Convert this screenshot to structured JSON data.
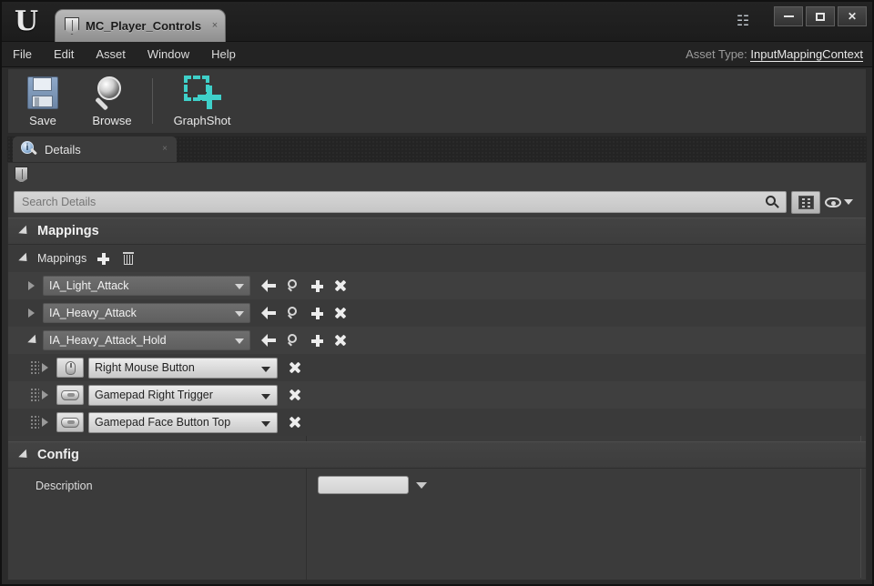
{
  "window": {
    "asset_tab_title": "MC_Player_Controls",
    "tab_close": "×",
    "minimize": "",
    "maximize": "",
    "close": "✕"
  },
  "menubar": {
    "items": [
      {
        "label": "File"
      },
      {
        "label": "Edit"
      },
      {
        "label": "Asset"
      },
      {
        "label": "Window"
      },
      {
        "label": "Help"
      }
    ],
    "asset_type_prefix": "Asset Type:",
    "asset_type_value": "InputMappingContext"
  },
  "toolbar": {
    "buttons": [
      {
        "label": "Save",
        "icon": "floppy-disk-icon"
      },
      {
        "label": "Browse",
        "icon": "magnifier-icon"
      },
      {
        "label": "GraphShot",
        "icon": "dashed-square-plus-icon"
      }
    ]
  },
  "details_tab": {
    "label": "Details",
    "close": "×"
  },
  "search": {
    "placeholder": "Search Details",
    "value": ""
  },
  "categories": {
    "mappings": {
      "title": "Mappings",
      "array_label": "Mappings",
      "add_tooltip": "Add Element",
      "delete_tooltip": "Remove All Elements",
      "entries": [
        {
          "name": "IA_Light_Attack",
          "expanded": false
        },
        {
          "name": "IA_Heavy_Attack",
          "expanded": false
        },
        {
          "name": "IA_Heavy_Attack_Hold",
          "expanded": true
        }
      ],
      "keys": [
        {
          "name": "Right Mouse Button",
          "device": "mouse-icon"
        },
        {
          "name": "Gamepad Right Trigger",
          "device": "gamepad-icon"
        },
        {
          "name": "Gamepad Face Button Top",
          "device": "gamepad-icon"
        }
      ]
    },
    "config": {
      "title": "Config",
      "description_label": "Description",
      "description_value": ""
    }
  },
  "colors": {
    "accent_teal": "#3fd0c9",
    "panel_bg": "#3b3b3b",
    "header_bg": "#434343",
    "field_light": "#d6d6d6"
  }
}
